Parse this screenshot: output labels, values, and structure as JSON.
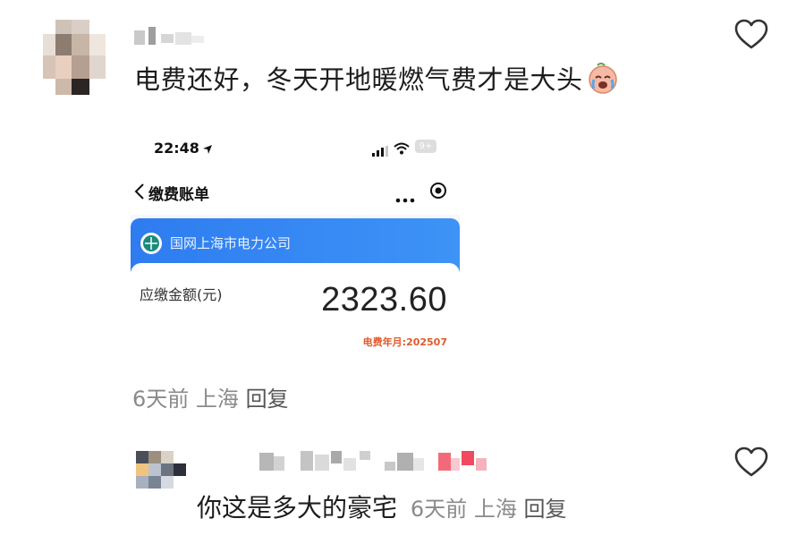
{
  "comment1": {
    "text": "电费还好，冬天开地暖燃气费才是大头",
    "emoji_icon": "crying-laughing-face-icon",
    "meta": {
      "time": "6天前",
      "location": "上海",
      "reply": "回复"
    },
    "heart_icon": "heart-outline-icon"
  },
  "screenshot": {
    "status_time": "22:48",
    "battery": "9+",
    "nav_title": "缴费账单",
    "company": "国网上海市电力公司",
    "due_label": "应缴金额(元)",
    "amount": "2323.60",
    "period": "电费年月:202507"
  },
  "comment2": {
    "text": "你这是多大的豪宅",
    "meta": {
      "time": "6天前",
      "location": "上海",
      "reply": "回复"
    },
    "heart_icon": "heart-outline-icon"
  },
  "colors": {
    "accent_blue": "#2e7cf0",
    "period_orange": "#e05a2a",
    "meta_gray": "#8a8a8a"
  }
}
